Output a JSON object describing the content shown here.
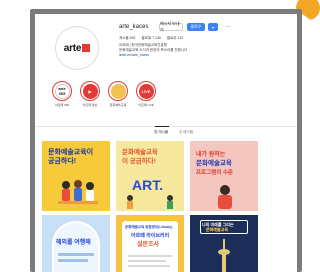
{
  "profile": {
    "username": "arte_kaces",
    "message_label": "메시지 보내기",
    "follow_label": "팔로우",
    "more_label": "···",
    "stats": {
      "posts": "게시물 492",
      "followers": "팔로워 7,130",
      "following": "팔로우 112"
    },
    "bio_lines": [
      "아르떼 | 한국문화예술교육진흥원",
      "문화예술교육 소식과 현장의 목소리를 전합니다",
      "linktr.ee/arte_kaces"
    ],
    "logo_text": "arte"
  },
  "highlights": [
    {
      "label": "아르떼 365",
      "inner_text": "arte 365",
      "color": "#ffffff",
      "text_color": "#111111"
    },
    {
      "label": "아르떼 영상",
      "inner_text": "▶",
      "color": "#e53935",
      "text_color": "#ffffff"
    },
    {
      "label": "문화예술교육",
      "inner_text": "",
      "color": "#f2c14e",
      "text_color": "#333333"
    },
    {
      "label": "아르떼 LIVE",
      "inner_text": "LIVE",
      "color": "#e53935",
      "text_color": "#ffffff"
    }
  ],
  "tabs": {
    "posts": "게시물",
    "tagged": "태그됨"
  },
  "posts": [
    {
      "lines": [
        "문화예술교육이",
        "궁금하다!"
      ]
    },
    {
      "lines": [
        "문화예술교육",
        "이 궁금하다!"
      ],
      "extra": "ART."
    },
    {
      "lines": [
        "내가 원하는",
        "문화예술교육",
        "프로그램의 수준"
      ]
    },
    {
      "lines": [
        "해외를 여행해",
        ""
      ]
    },
    {
      "lines": [
        "문화예술교육 종합정보(Library)",
        "아르떼 라이브러리",
        "설문조사"
      ]
    },
    {
      "lines": [
        "나의 미래를 그리는",
        "문화예술교육"
      ]
    }
  ],
  "colors": {
    "frame": "#7b7b7b",
    "accent_orange": "#f5a623",
    "follow_blue": "#3b82f6",
    "highlight_ring": "#e53935"
  }
}
